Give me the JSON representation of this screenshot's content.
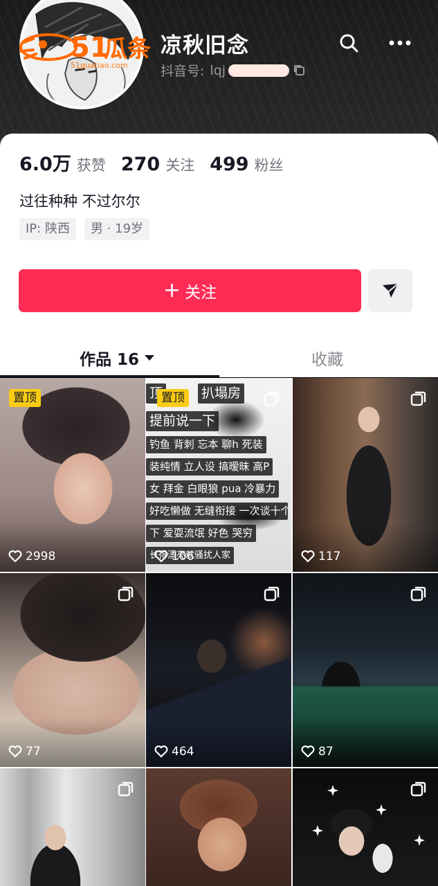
{
  "header": {
    "nickname": "凉秋旧念",
    "douyin_id_label": "抖音号:",
    "douyin_id_visible": "lqj",
    "watermark_brand": "51瓜条",
    "watermark_url": "51guatiao.com"
  },
  "stats": [
    {
      "value": "6.0万",
      "label": "获赞"
    },
    {
      "value": "270",
      "label": "关注"
    },
    {
      "value": "499",
      "label": "粉丝"
    }
  ],
  "bio": "过往种种 不过尔尔",
  "tags": [
    "IP: 陕西",
    "男 · 19岁"
  ],
  "follow_button": {
    "label": "关注"
  },
  "tabs": {
    "works": "作品 16",
    "favorites": "收藏"
  },
  "videos": [
    {
      "likes": "2998",
      "pinned": true,
      "pin_label": "置顶",
      "multi": false
    },
    {
      "likes": "106",
      "pinned": true,
      "pin_label": "置顶",
      "multi": true,
      "overlay_lines": [
        "顶",
        "扒塌房",
        "提前说一下",
        "钓鱼 背刺 忘本 聊h 死装",
        "装纯情 立人设 搞暧昧 高P",
        "女 拜金 白眼狼 pua 冷暴力",
        "好吃懒做 无缝衔接 一次谈十个",
        "下 爱耍流氓 好色 哭穷",
        "长得漂亮就骚扰人家"
      ]
    },
    {
      "likes": "117",
      "pinned": false,
      "multi": true
    },
    {
      "likes": "77",
      "pinned": false,
      "multi": true
    },
    {
      "likes": "464",
      "pinned": false,
      "multi": true
    },
    {
      "likes": "87",
      "pinned": false,
      "multi": true
    },
    {
      "likes": "",
      "pinned": false,
      "multi": true
    },
    {
      "likes": "",
      "pinned": false,
      "multi": false
    },
    {
      "likes": "",
      "pinned": false,
      "multi": true
    }
  ],
  "colors": {
    "follow": "#fe2c55",
    "pin": "#facc15",
    "text_primary": "#161823",
    "text_secondary": "#73757c"
  }
}
